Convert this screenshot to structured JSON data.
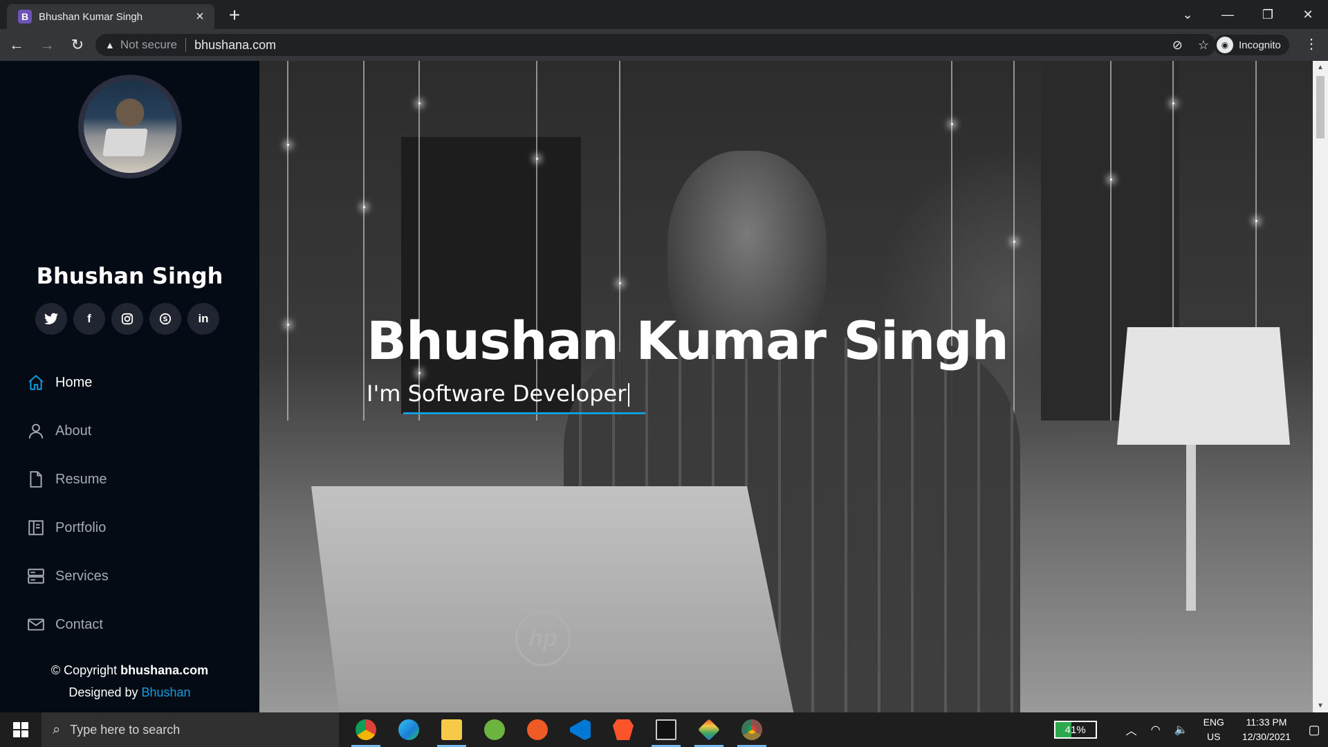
{
  "browser": {
    "tab_title": "Bhushan Kumar Singh",
    "favicon_letter": "B",
    "security_label": "Not secure",
    "url": "bhushana.com",
    "profile_label": "Incognito"
  },
  "sidebar": {
    "name": "Bhushan Singh",
    "socials": [
      {
        "label": "twitter"
      },
      {
        "label": "facebook"
      },
      {
        "label": "instagram"
      },
      {
        "label": "skype"
      },
      {
        "label": "linkedin"
      }
    ],
    "nav": [
      {
        "label": "Home",
        "icon": "home-icon",
        "active": true
      },
      {
        "label": "About",
        "icon": "person-icon",
        "active": false
      },
      {
        "label": "Resume",
        "icon": "file-icon",
        "active": false
      },
      {
        "label": "Portfolio",
        "icon": "book-icon",
        "active": false
      },
      {
        "label": "Services",
        "icon": "server-icon",
        "active": false
      },
      {
        "label": "Contact",
        "icon": "envelope-icon",
        "active": false
      }
    ],
    "footer": {
      "copyright_prefix": "© Copyright ",
      "copyright_site": "bhushana.com",
      "designed_prefix": "Designed by ",
      "designer": "Bhushan"
    }
  },
  "hero": {
    "title": "Bhushan Kumar Singh",
    "subtitle_prefix": "I'm ",
    "subtitle_role": "Software Developer"
  },
  "taskbar": {
    "search_placeholder": "Type here to search",
    "battery": "41%",
    "battery_level": 0.41,
    "lang_line1": "ENG",
    "lang_line2": "US",
    "time": "11:33 PM",
    "date": "12/30/2021",
    "apps": [
      "chrome",
      "edge",
      "file-explorer",
      "spring-tool",
      "postman",
      "vscode",
      "brave",
      "terminal",
      "git",
      "chrome-incognito"
    ]
  },
  "colors": {
    "accent": "#149ddd",
    "sidebar_bg": "#040b14",
    "social_bg": "#212431"
  }
}
